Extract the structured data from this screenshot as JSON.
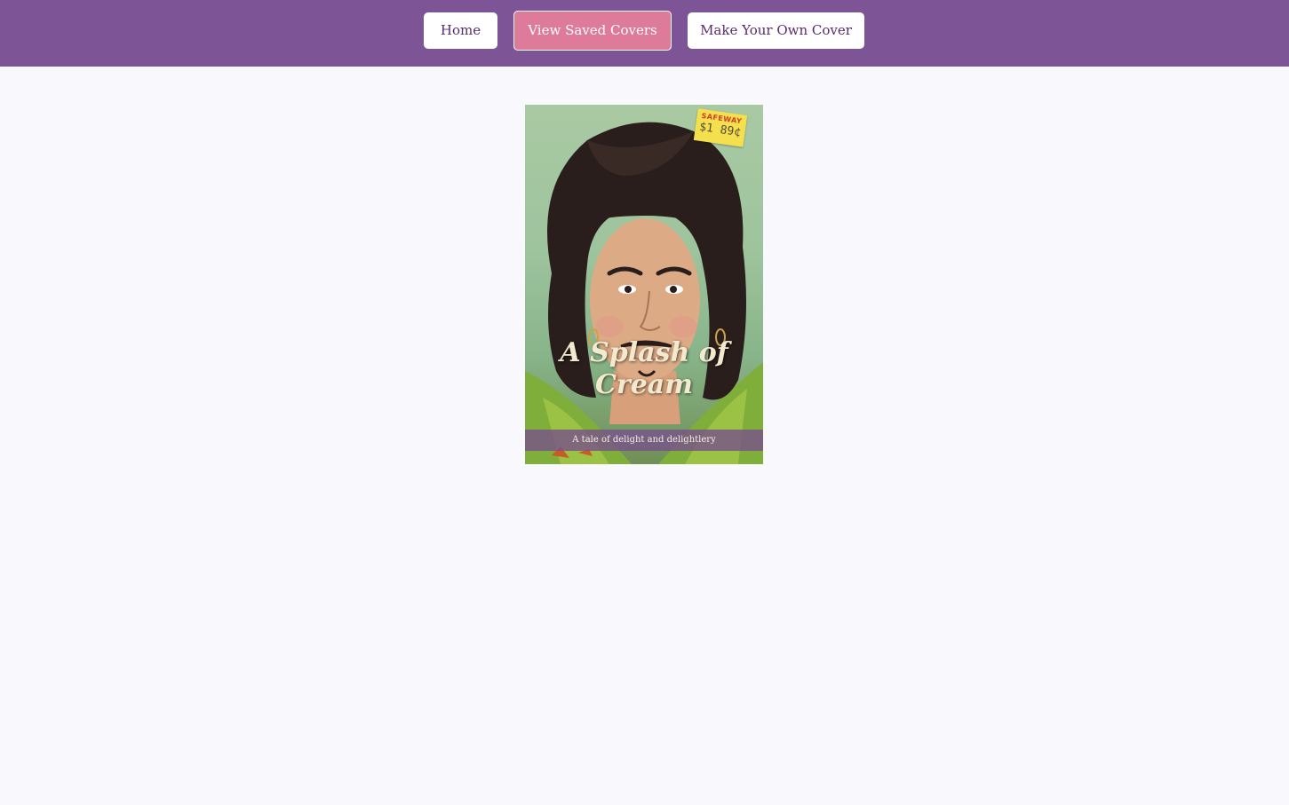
{
  "nav": {
    "home_label": "Home",
    "saved_label": "View Saved Covers",
    "make_label": "Make Your Own Cover"
  },
  "cover": {
    "title": "A Splash of Cream",
    "tagline": "A tale of delight and delightlery",
    "sticker_store": "SAFEWAY",
    "sticker_price": "$1 89¢"
  },
  "colors": {
    "topbar": "#7d5597",
    "active_button": "#df7b9a",
    "button_text": "#5a2a6e",
    "page_background": "#f8f8fd",
    "cover_title": "#f3e9cf"
  }
}
